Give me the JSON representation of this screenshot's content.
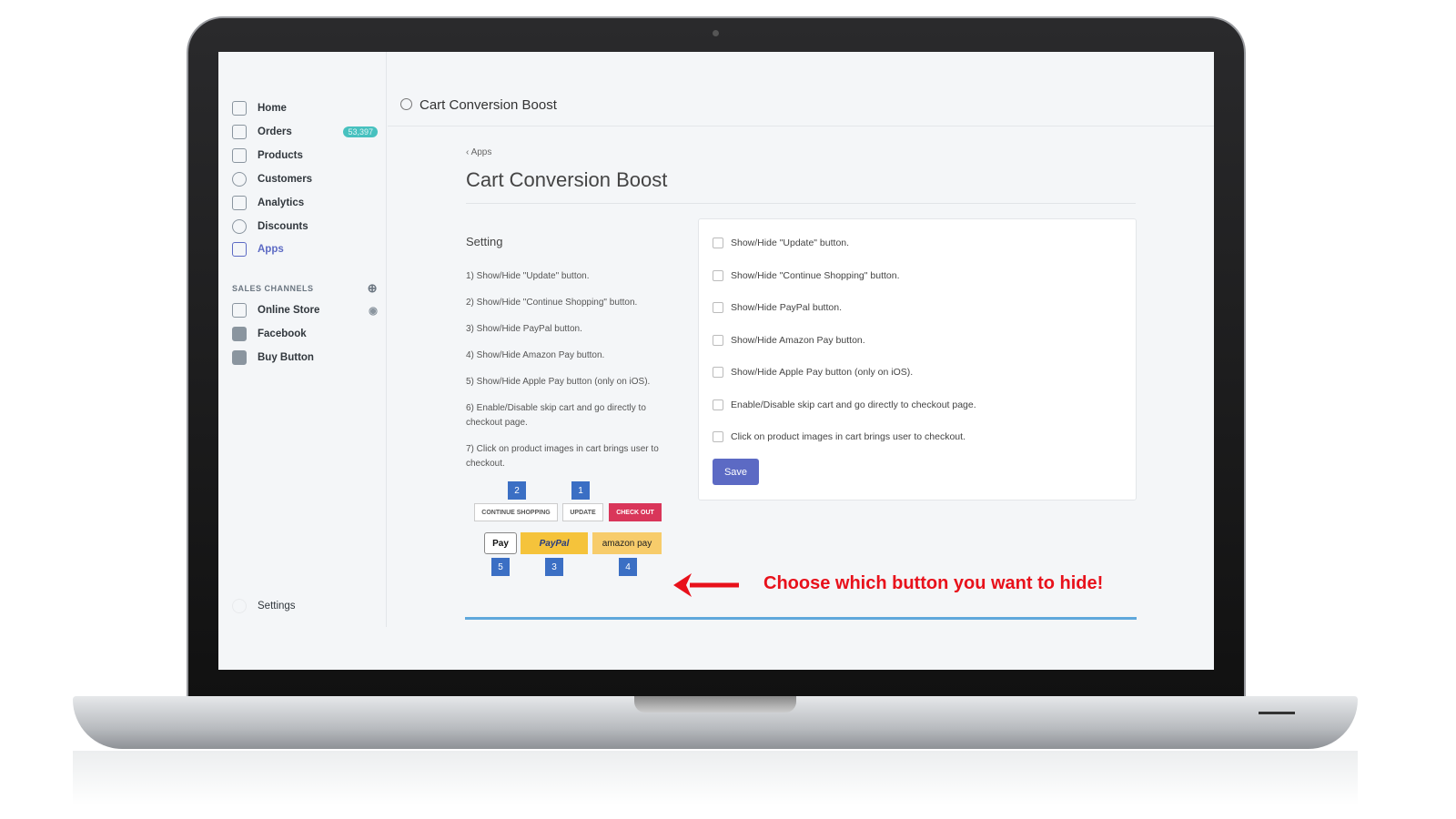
{
  "sidebar": {
    "items": [
      {
        "label": "Home"
      },
      {
        "label": "Orders",
        "badge": "53,397"
      },
      {
        "label": "Products"
      },
      {
        "label": "Customers"
      },
      {
        "label": "Analytics"
      },
      {
        "label": "Discounts"
      },
      {
        "label": "Apps",
        "active": true
      }
    ],
    "sales_channels_label": "SALES CHANNELS",
    "channels": [
      {
        "label": "Online Store"
      },
      {
        "label": "Facebook"
      },
      {
        "label": "Buy Button"
      }
    ],
    "settings_label": "Settings"
  },
  "header": {
    "title": "Cart Conversion Boost"
  },
  "page": {
    "breadcrumb": "Apps",
    "title": "Cart Conversion Boost",
    "section_title": "Setting",
    "descriptions": [
      "1) Show/Hide \"Update\" button.",
      "2) Show/Hide \"Continue Shopping\" button.",
      "3) Show/Hide PayPal button.",
      "4) Show/Hide Amazon Pay button.",
      "5) Show/Hide Apple Pay button (only on iOS).",
      "6) Enable/Disable skip cart and go directly to checkout page.",
      "7) Click on product images in cart brings user to checkout."
    ],
    "options": [
      "Show/Hide \"Update\" button.",
      "Show/Hide \"Continue Shopping\" button.",
      "Show/Hide PayPal button.",
      "Show/Hide Amazon Pay button.",
      "Show/Hide Apple Pay button (only on iOS).",
      "Enable/Disable skip cart and go directly to checkout page.",
      "Click on product images in cart brings user to checkout."
    ],
    "save_label": "Save"
  },
  "illustration": {
    "continue": "CONTINUE SHOPPING",
    "update": "UPDATE",
    "checkout": "CHECK OUT",
    "applepay": "Pay",
    "paypal": "PayPal",
    "amazon": "amazon pay",
    "numbers": [
      "2",
      "1",
      "5",
      "3",
      "4"
    ]
  },
  "callout": {
    "text": "Choose which button you want to hide!",
    "color": "#e8111b"
  },
  "colors": {
    "accent": "#5c6ac4",
    "badge": "#47c1bf",
    "checkout": "#d9365a",
    "paypal": "#f5c33b"
  }
}
